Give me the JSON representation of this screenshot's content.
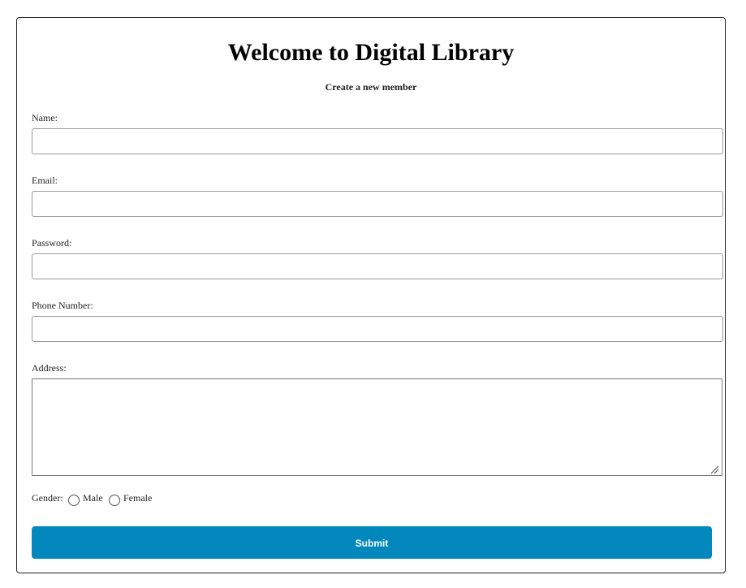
{
  "form": {
    "title": "Welcome to Digital Library",
    "subtitle": "Create a new member",
    "name_label": "Name:",
    "name_value": "",
    "email_label": "Email:",
    "email_value": "",
    "password_label": "Password:",
    "password_value": "",
    "phone_label": "Phone Number:",
    "phone_value": "",
    "address_label": "Address:",
    "address_value": "",
    "gender_label": "Gender:",
    "gender_options": [
      "Male",
      "Female"
    ],
    "submit_label": "Submit"
  },
  "colors": {
    "accent": "#0288bd",
    "border": "#222222"
  },
  "icons": [
    "resize-grip-icon"
  ]
}
